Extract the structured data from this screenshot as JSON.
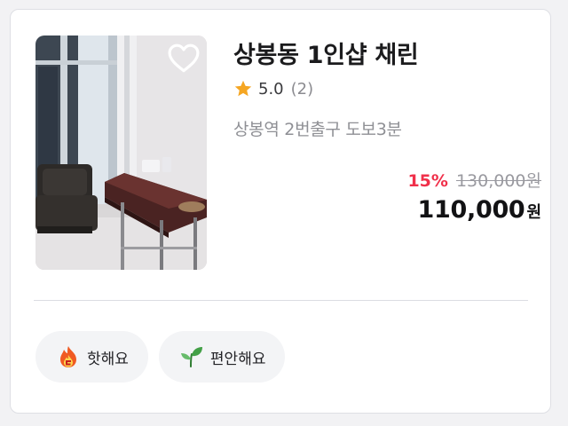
{
  "listing": {
    "title": "상봉동 1인샵 채린",
    "rating": {
      "score": "5.0",
      "count": "(2)"
    },
    "location": "상봉역 2번출구 도보3분",
    "price": {
      "discount": "15%",
      "original": "130,000원",
      "sale": "110,000",
      "currency": "원"
    },
    "favorite": false
  },
  "tags": [
    {
      "label": "핫해요",
      "icon": "fire-icon"
    },
    {
      "label": "편안해요",
      "icon": "leaf-icon"
    }
  ],
  "colors": {
    "discount": "#f0304a",
    "star": "#f5a623",
    "border": "#dedfe4",
    "tag_background": "#f3f4f6"
  }
}
